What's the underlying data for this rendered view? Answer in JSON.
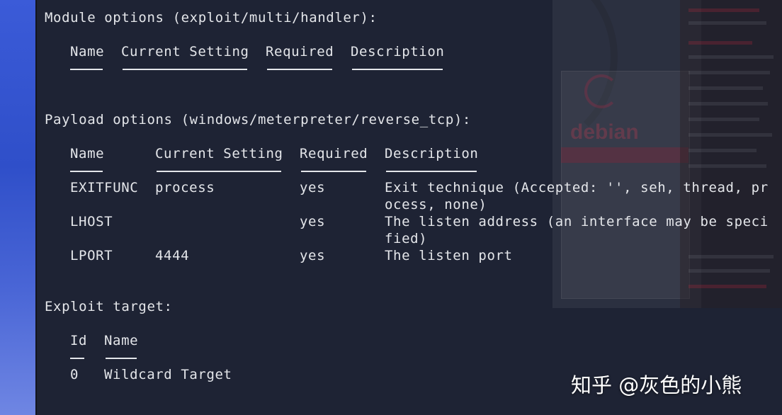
{
  "terminal": {
    "module_header": "Module options (exploit/multi/handler):",
    "module_columns": [
      "Name",
      "Current Setting",
      "Required",
      "Description"
    ],
    "payload_header": "Payload options (windows/meterpreter/reverse_tcp):",
    "payload_columns": [
      "Name",
      "Current Setting",
      "Required",
      "Description"
    ],
    "payload_rows": [
      {
        "name": "EXITFUNC",
        "setting": "process",
        "required": "yes",
        "description": "Exit technique (Accepted: '', seh, thread, pr",
        "description_cont": "ocess, none)"
      },
      {
        "name": "LHOST",
        "setting": "",
        "required": "yes",
        "description": "The listen address (an interface may be speci",
        "description_cont": "fied)"
      },
      {
        "name": "LPORT",
        "setting": "4444",
        "required": "yes",
        "description": "The listen port",
        "description_cont": ""
      }
    ],
    "target_header": "Exploit target:",
    "target_columns": [
      "Id",
      "Name"
    ],
    "target_rows": [
      {
        "id": "0",
        "name": "Wildcard Target"
      }
    ]
  },
  "background": {
    "logo_text": "debian"
  },
  "watermark": "知乎 @灰色的小熊"
}
